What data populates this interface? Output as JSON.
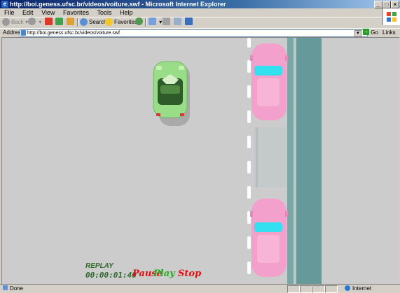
{
  "window": {
    "title": "http://boi.geness.ufsc.br/videos/voiture.swf - Microsoft Internet Explorer",
    "minimize": "_",
    "maximize": "□",
    "close": "×"
  },
  "menu": {
    "items": [
      "File",
      "Edit",
      "View",
      "Favorites",
      "Tools",
      "Help"
    ]
  },
  "toolbar": {
    "back": "Back",
    "search": "Search",
    "favorites": "Favorites"
  },
  "address": {
    "label": "Address",
    "url": "http://boi.geness.ufsc.br/videos/voiture.swf",
    "go": "Go",
    "links": "Links"
  },
  "flash": {
    "replay_label": "REPLAY",
    "time": "00:00:01:40",
    "controls": {
      "pause": "Pause",
      "play": "Play",
      "stop": "Stop"
    },
    "colors": {
      "background": "#cccccc",
      "player_car": "#99dd88",
      "parked_car": "#f4a0cc",
      "sidewalk": "#669999",
      "pause": "#dd1111",
      "play": "#22aa22",
      "stop": "#dd1111"
    }
  },
  "status": {
    "text": "Done",
    "zone": "Internet"
  }
}
